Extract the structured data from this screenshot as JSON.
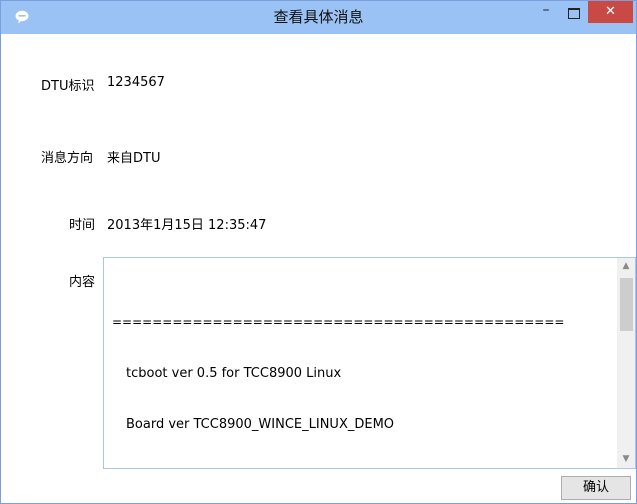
{
  "window": {
    "title": "查看具体消息",
    "icon": "chat-bubble-icon",
    "controls": {
      "minimize": "–",
      "close": "✕"
    }
  },
  "fields": {
    "dtu_id_label": "DTU标识",
    "dtu_id_value": "1234567",
    "direction_label": "消息方向",
    "direction_value": "来自DTU",
    "time_label": "时间",
    "time_value": "2013年1月15日 12:35:47",
    "content_label": "内容"
  },
  "content": {
    "lines": [
      "=============================================",
      "tcboot ver 0.5 for TCC8900 Linux",
      "Board ver TCC8900_WINCE_LINUX_DEMO"
    ]
  },
  "buttons": {
    "ok": "确认"
  },
  "colors": {
    "titlebar": "#9ac2f4",
    "close": "#c94a44",
    "border": "#7a9fdc"
  }
}
